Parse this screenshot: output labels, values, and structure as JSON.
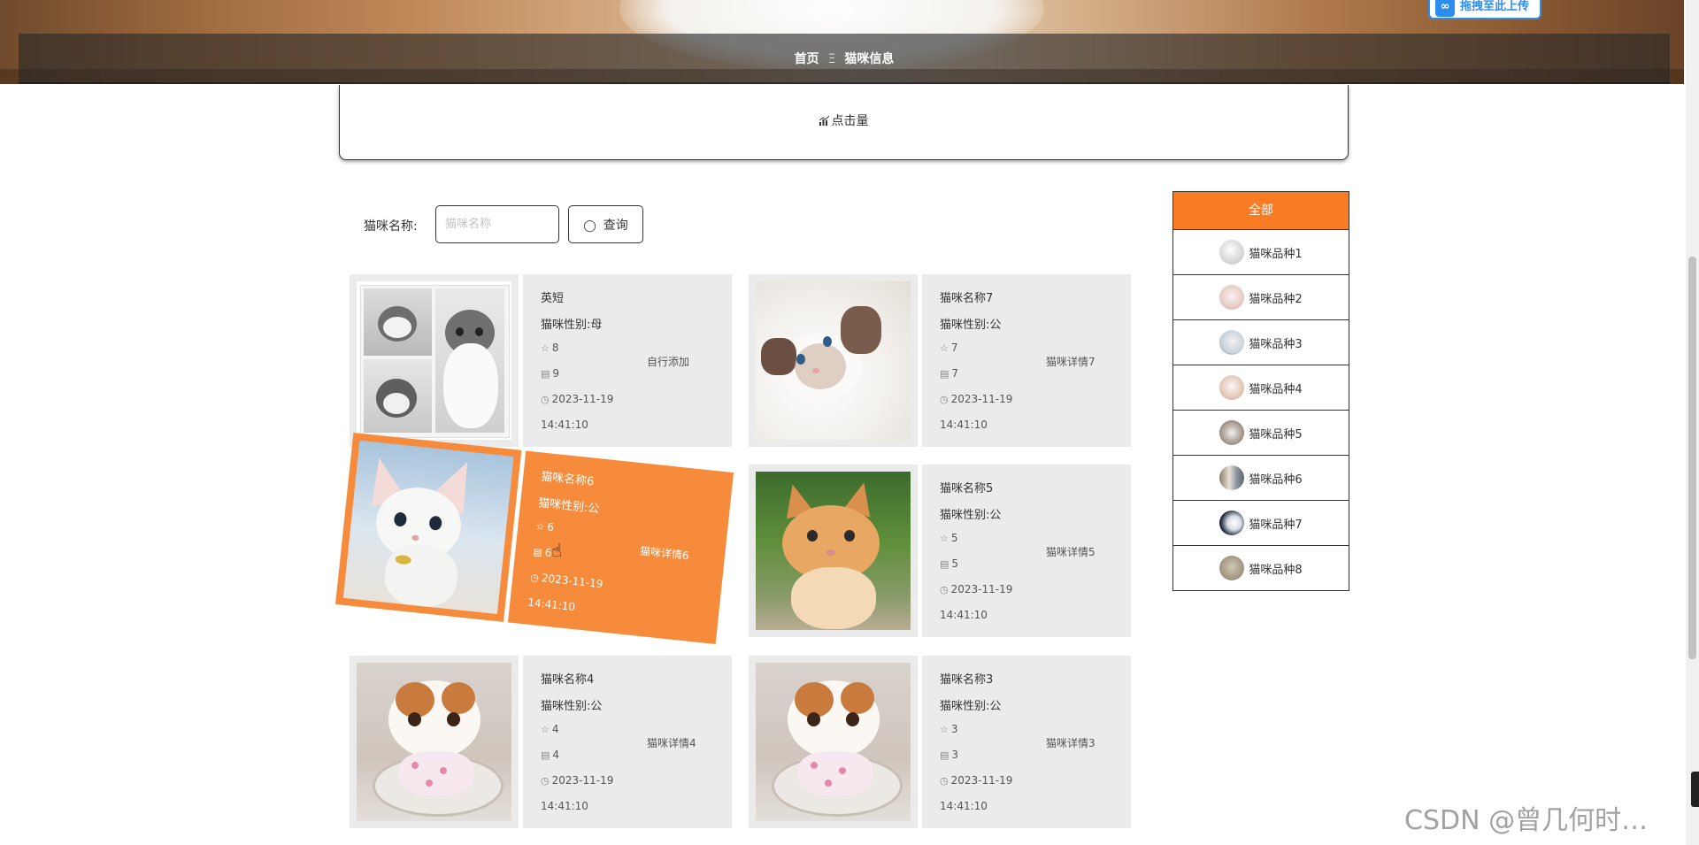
{
  "banner": {
    "breadcrumb": [
      "首页",
      "猫咪信息"
    ],
    "separator": "Ξ",
    "upload_badge": "拖拽至此上传"
  },
  "stats": {
    "icon": "bar-chart-icon",
    "label": "点击量"
  },
  "search": {
    "label": "猫咪名称:",
    "placeholder": "猫咪名称",
    "value": "",
    "button_label": "查询",
    "button_icon": "search-icon"
  },
  "cards": [
    {
      "title": "英短",
      "gender": "猫咪性别:母",
      "favorites": "8",
      "comments": "9",
      "date": "2023-11-19",
      "time": "14:41:10",
      "detail": "自行添加",
      "photo": "collage-grey-kittens"
    },
    {
      "title": "猫咪名称7",
      "gender": "猫咪性别:公",
      "favorites": "7",
      "comments": "7",
      "date": "2023-11-19",
      "time": "14:41:10",
      "detail": "猫咪详情7",
      "photo": "ragdoll-kitten"
    },
    {
      "title": "猫咪名称6",
      "gender": "猫咪性别:公",
      "favorites": "6",
      "comments": "6",
      "date": "2023-11-19",
      "time": "14:41:10",
      "detail": "猫咪详情6",
      "photo": "white-sphynx-kitten",
      "highlighted": true
    },
    {
      "title": "猫咪名称5",
      "gender": "猫咪性别:公",
      "favorites": "5",
      "comments": "5",
      "date": "2023-11-19",
      "time": "14:41:10",
      "detail": "猫咪详情5",
      "photo": "orange-tabby-kitten"
    },
    {
      "title": "猫咪名称4",
      "gender": "猫咪性别:公",
      "favorites": "4",
      "comments": "4",
      "date": "2023-11-19",
      "time": "14:41:10",
      "detail": "猫咪详情4",
      "photo": "exotic-shorthair-kitten"
    },
    {
      "title": "猫咪名称3",
      "gender": "猫咪性别:公",
      "favorites": "3",
      "comments": "3",
      "date": "2023-11-19",
      "time": "14:41:10",
      "detail": "猫咪详情3",
      "photo": "exotic-shorthair-kitten"
    }
  ],
  "categories": {
    "header": "全部",
    "items": [
      "猫咪品种1",
      "猫咪品种2",
      "猫咪品种3",
      "猫咪品种4",
      "猫咪品种5",
      "猫咪品种6",
      "猫咪品种7",
      "猫咪品种8"
    ]
  },
  "icons": {
    "favorite": "star-icon",
    "comment": "comment-icon",
    "date": "clock-icon"
  },
  "colors": {
    "accent": "#f97c25",
    "card_highlight": "#f68b3b",
    "card_bg": "#ebebeb"
  },
  "watermark": "CSDN @曾几何时…"
}
